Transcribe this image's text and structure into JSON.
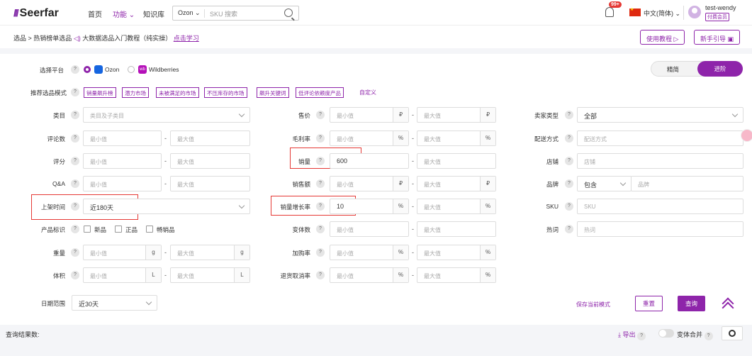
{
  "topbar": {
    "logo": "Seerfar",
    "nav": [
      "首页",
      "功能",
      "知识库"
    ],
    "search_platform": "Ozon",
    "search_placeholder": "SKU 搜索",
    "badge": "99+",
    "language": "中文(简体)",
    "username": "test-wendy",
    "member_label": "付费会员"
  },
  "breadcrumb": {
    "root": "选品",
    "current": "热销榜单选品",
    "tutorial": "大数据选品入门教程（纯实操）",
    "learn_link": "点击学习"
  },
  "top_buttons": {
    "tutorial": "使用教程",
    "guide": "新手引导"
  },
  "platform": {
    "label": "选择平台",
    "options": [
      "Ozon",
      "Wildberries"
    ],
    "selected": "Ozon"
  },
  "mode_toggle": {
    "simple": "精简",
    "advanced": "进阶",
    "active": "进阶"
  },
  "recommend": {
    "label": "推荐选品模式",
    "tags": [
      "销量飙升榜",
      "潜力市场",
      "未被满足的市场",
      "不压库存的市场",
      "飙升关键词",
      "低评论依赖度产品"
    ],
    "custom": "自定义"
  },
  "filters": {
    "category": {
      "label": "类目",
      "placeholder": "类目及子类目"
    },
    "reviews": {
      "label": "评论数"
    },
    "rating": {
      "label": "评分"
    },
    "qa": {
      "label": "Q&A"
    },
    "listing_time": {
      "label": "上架时间",
      "value": "近180天"
    },
    "product_tag": {
      "label": "产品标识",
      "options": [
        "新品",
        "正品",
        "畅销品"
      ]
    },
    "weight": {
      "label": "重量",
      "unit": "g"
    },
    "volume": {
      "label": "体积",
      "unit": "L"
    },
    "price": {
      "label": "售价",
      "unit": "₽"
    },
    "gross_margin": {
      "label": "毛利率",
      "unit": "%"
    },
    "sales": {
      "label": "销量",
      "value": "600"
    },
    "revenue": {
      "label": "销售额",
      "unit": "₽"
    },
    "sales_growth": {
      "label": "销量增长率",
      "value": "10",
      "unit": "%"
    },
    "variants": {
      "label": "变体数"
    },
    "cart_rate": {
      "label": "加购率",
      "unit": "%"
    },
    "return_rate": {
      "label": "退货取消率",
      "unit": "%"
    },
    "seller_type": {
      "label": "卖家类型",
      "value": "全部"
    },
    "delivery": {
      "label": "配送方式",
      "placeholder": "配送方式"
    },
    "shop": {
      "label": "店铺",
      "placeholder": "店铺"
    },
    "brand": {
      "label": "品牌",
      "mode": "包含",
      "placeholder": "品牌"
    },
    "sku": {
      "label": "SKU",
      "placeholder": "SKU"
    },
    "hotword": {
      "label": "热词",
      "placeholder": "热词"
    },
    "min_placeholder": "最小值",
    "max_placeholder": "最大值",
    "help": "?",
    "dash": "-"
  },
  "date_range": {
    "label": "日期范围",
    "value": "近30天"
  },
  "actions": {
    "save_mode": "保存当前模式",
    "reset": "重置",
    "query": "查询"
  },
  "bottom": {
    "result_label": "查询结果数:",
    "export": "导出",
    "merge_variants": "变体合并"
  }
}
